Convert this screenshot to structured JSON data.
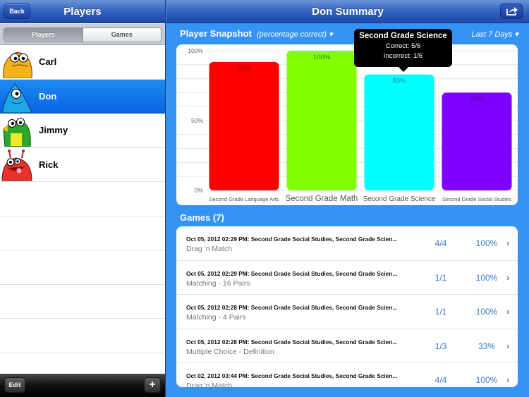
{
  "left_pane": {
    "title": "Players",
    "back_label": "Back",
    "segments": [
      {
        "label": "Players",
        "selected": true
      },
      {
        "label": "Games",
        "selected": false
      }
    ],
    "players": [
      {
        "name": "Carl",
        "avatar": "yellow-monster-avatar",
        "color": "#f6b21a",
        "selected": false
      },
      {
        "name": "Don",
        "avatar": "blue-monster-avatar",
        "color": "#1f9ee0",
        "selected": true
      },
      {
        "name": "Jimmy",
        "avatar": "green-monster-avatar",
        "color": "#2ca82c",
        "selected": false
      },
      {
        "name": "Rick",
        "avatar": "red-monster-avatar",
        "color": "#e8322a",
        "selected": false
      }
    ],
    "edit_label": "Edit",
    "add_label": "+"
  },
  "right_pane": {
    "title": "Don Summary",
    "share_icon": "share-icon",
    "snapshot": {
      "title": "Player Snapshot",
      "subtitle": "(percentage correct) ▾",
      "range_label": "Last 7 Days ▾"
    },
    "tooltip": {
      "title": "Second Grade Science",
      "correct": "Correct: 5/6",
      "incorrect": "Incorrect: 1/6"
    },
    "games": {
      "title": "Games (7)",
      "rows": [
        {
          "title": "Oct 05, 2012  02:29 PM: Second Grade Social Studies, Second Grade Scien...",
          "type": "Drag 'n Match",
          "score": "4/4",
          "percent": "100%"
        },
        {
          "title": "Oct 05, 2012  02:29 PM: Second Grade Social Studies, Second Grade Scien...",
          "type": "Matching - 16 Pairs",
          "score": "1/1",
          "percent": "100%"
        },
        {
          "title": "Oct 05, 2012  02:28 PM: Second Grade Social Studies, Second Grade Scien...",
          "type": "Matching - 4 Pairs",
          "score": "1/1",
          "percent": "100%"
        },
        {
          "title": "Oct 05, 2012  02:28 PM: Second Grade Social Studies, Second Grade Scien...",
          "type": "Multiple Choice - Definition",
          "score": "1/3",
          "percent": "33%"
        },
        {
          "title": "Oct 02, 2012  03:44 PM: Second Grade Social Studies, Second Grade Scien...",
          "type": "Drag 'n Match",
          "score": "4/4",
          "percent": "100%"
        }
      ]
    }
  },
  "chart_data": {
    "type": "bar",
    "title": "Player Snapshot",
    "subtitle": "(percentage correct)",
    "categories": [
      "Second Grade Language Arts",
      "Second Grade Math",
      "Second Grade Science",
      "Second Grade Social Studies"
    ],
    "values": [
      92,
      100,
      83,
      70
    ],
    "data_labels": [
      "92%",
      "100%",
      "83%",
      "70%"
    ],
    "colors": [
      "#ff0000",
      "#80ff00",
      "#00ffff",
      "#8000ff"
    ],
    "label_colors": [
      "#8a1010",
      "#3d7a00",
      "#108a8a",
      "#4a0090"
    ],
    "yticks": [
      "0%",
      "50%",
      "100%"
    ],
    "ylim": [
      0,
      100
    ],
    "grid": true,
    "xlabel": "",
    "ylabel": ""
  }
}
